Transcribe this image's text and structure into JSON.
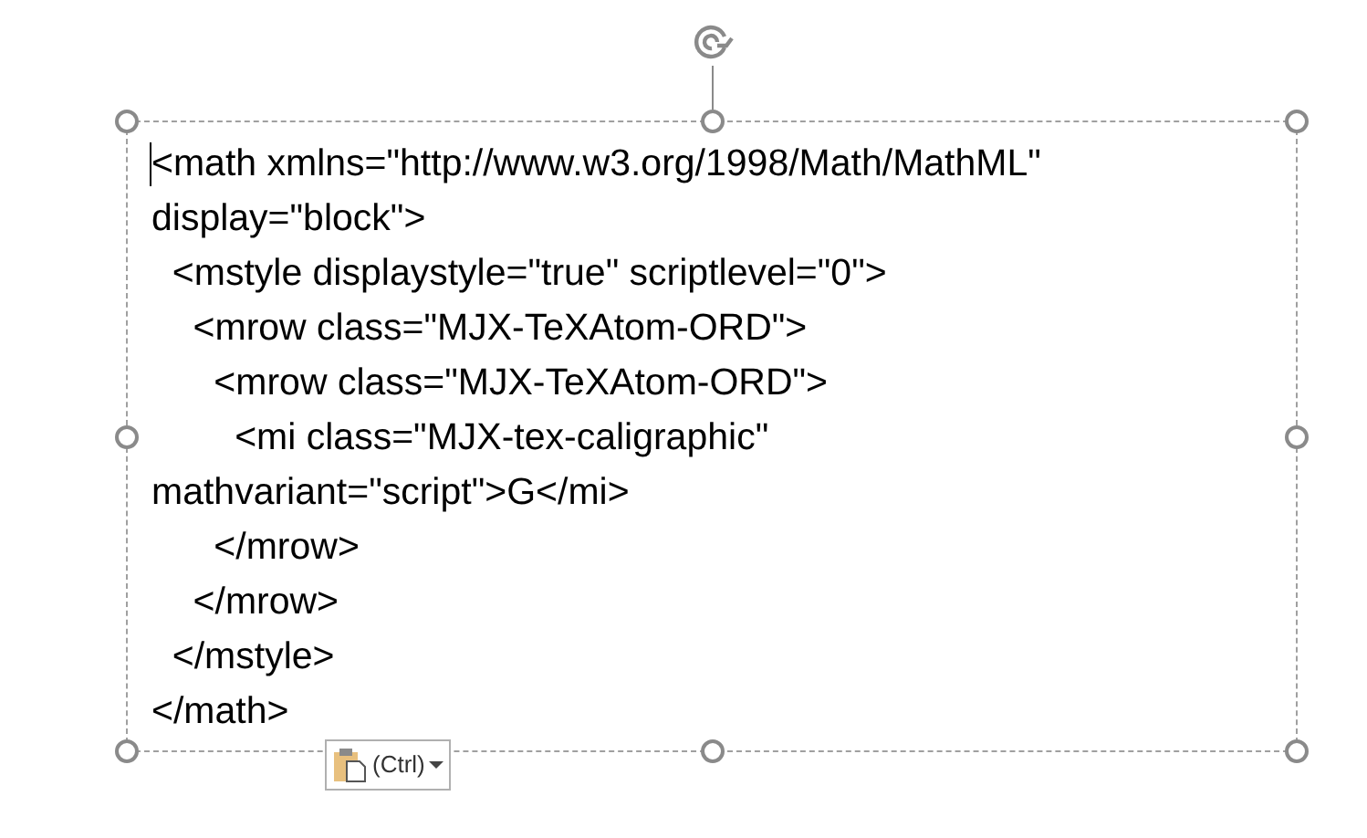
{
  "text_box": {
    "lines": [
      "<math xmlns=\"http://www.w3.org/1998/Math/MathML\"",
      "display=\"block\">",
      "  <mstyle displaystyle=\"true\" scriptlevel=\"0\">",
      "    <mrow class=\"MJX-TeXAtom-ORD\">",
      "      <mrow class=\"MJX-TeXAtom-ORD\">",
      "        <mi class=\"MJX-tex-caligraphic\"",
      "mathvariant=\"script\">G</mi>",
      "      </mrow>",
      "    </mrow>",
      "  </mstyle>",
      "</math>"
    ]
  },
  "paste_options": {
    "label": "(Ctrl)"
  }
}
